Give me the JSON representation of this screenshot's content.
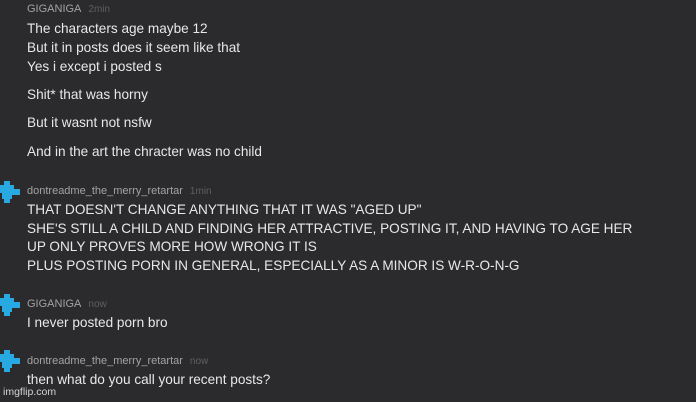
{
  "colors": {
    "background": "#2b2b2d",
    "text": "#e8e8e8",
    "author": "#a3a3a3",
    "timestamp": "#5f5f63",
    "avatar_blue": "#29a9e1"
  },
  "messages": [
    {
      "author": "GIGANIGA",
      "time": "2min",
      "avatar_icon": "blue-pixel-avatar-icon",
      "lines": [
        "The characters age maybe 12",
        "But it in posts does it seem like that",
        "Yes i except i posted s",
        "Shit* that was horny",
        "But it wasnt not nsfw",
        "And in the art the chracter was no child"
      ]
    },
    {
      "author": "dontreadme_the_merry_retartar",
      "time": "1min",
      "avatar_icon": "blue-pixel-avatar-icon",
      "lines": [
        "THAT DOESN'T CHANGE ANYTHING THAT IT WAS \"AGED UP\"",
        "SHE'S STILL A CHILD AND FINDING HER ATTRACTIVE, POSTING IT, AND HAVING TO AGE HER",
        "UP ONLY PROVES MORE HOW WRONG IT IS",
        "PLUS POSTING PORN IN GENERAL, ESPECIALLY AS A MINOR IS W-R-O-N-G"
      ]
    },
    {
      "author": "GIGANIGA",
      "time": "now",
      "avatar_icon": "blue-pixel-avatar-icon",
      "lines": [
        "I never posted porn bro"
      ]
    },
    {
      "author": "dontreadme_the_merry_retartar",
      "time": "now",
      "avatar_icon": "blue-pixel-avatar-icon",
      "lines": [
        "then what do you call your recent posts?"
      ]
    }
  ],
  "watermark": "imgflip.com"
}
